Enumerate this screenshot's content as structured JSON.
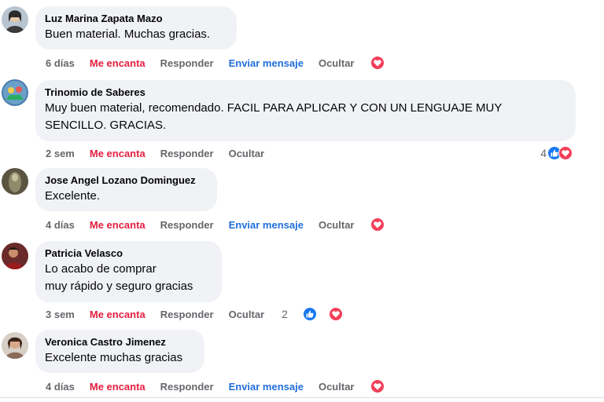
{
  "comments": [
    {
      "author": "Luz Marina Zapata Mazo",
      "text": "Buen material. Muchas gracias.",
      "time": "6 días",
      "love_label": "Me encanta",
      "reply_label": "Responder",
      "message_label": "Enviar mensaje",
      "hide_label": "Ocultar",
      "avatar_color": "#b8c4cf"
    },
    {
      "author": "Trinomio de Saberes",
      "text": "Muy buen material, recomendado. FACIL PARA APLICAR Y CON UN LENGUAJE MUY\nSENCILLO. GRACIAS.",
      "time": "2 sem",
      "love_label": "Me encanta",
      "reply_label": "Responder",
      "hide_label": "Ocultar",
      "reaction_count": "4",
      "avatar_color": "#4a7bb0"
    },
    {
      "author": "Jose Angel Lozano Dominguez",
      "text": "Excelente.",
      "time": "4 días",
      "love_label": "Me encanta",
      "reply_label": "Responder",
      "message_label": "Enviar mensaje",
      "hide_label": "Ocultar",
      "avatar_color": "#5a5440"
    },
    {
      "author": "Patricia Velasco",
      "text": "Lo acabo de comprar\nmuy rápido y seguro gracias",
      "time": "3 sem",
      "love_label": "Me encanta",
      "reply_label": "Responder",
      "hide_label": "Ocultar",
      "reaction_count": "2",
      "avatar_color": "#6b2a2a"
    },
    {
      "author": "Veronica Castro Jimenez",
      "text": "Excelente muchas gracias",
      "time": "4 días",
      "love_label": "Me encanta",
      "reply_label": "Responder",
      "message_label": "Enviar mensaje",
      "hide_label": "Ocultar",
      "avatar_color": "#8a6b5a"
    }
  ],
  "colors": {
    "love": "#e41e3f",
    "link": "#216fdb",
    "muted": "#65676b",
    "bubble": "#f0f2f5",
    "like": "#1877f2",
    "heart": "#f33e58"
  },
  "icons": {
    "like": "thumbs-up-icon",
    "heart": "heart-icon"
  }
}
